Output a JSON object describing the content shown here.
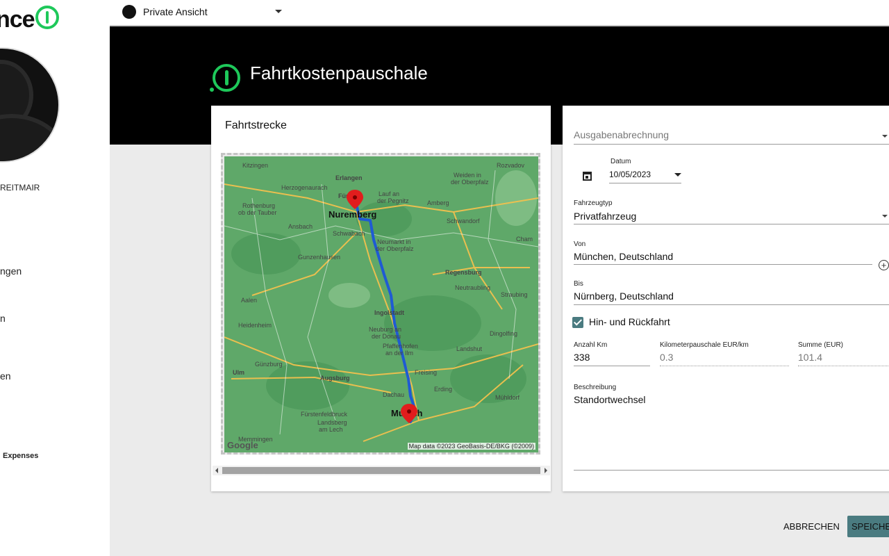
{
  "sidebar": {
    "logo_text": "nce",
    "user_name": "REITMAIR",
    "items": [
      {
        "label": "ngen"
      },
      {
        "label": "n"
      },
      {
        "label": "en"
      },
      {
        "label": "Expenses"
      }
    ]
  },
  "topbar": {
    "view_label": "Private Ansicht"
  },
  "header": {
    "title": "Fahrtkostenpauschale"
  },
  "map_card": {
    "title": "Fahrtstrecke",
    "attribution": "Map data ©2023 GeoBasis-DE/BKG (©2009)",
    "google": "Google",
    "places": [
      "Kitzingen",
      "Erlangen",
      "Weiden in",
      "der Oberpfalz",
      "Rozvadov",
      "Herzogenaurach",
      "Fürth",
      "Lauf an",
      "der Pegnitz",
      "Amberg",
      "Rothenburg",
      "ob der Tauber",
      "Nuremberg",
      "Schwandorf",
      "Ansbach",
      "Schwabach",
      "Neumarkt in",
      "der Oberpfalz",
      "Cham",
      "Gunzenhausen",
      "Regensburg",
      "Neutraubling",
      "Straubing",
      "Aalen",
      "Ingolstadt",
      "Heidenheim",
      "Neuburg an",
      "der Donau",
      "Dingolfing",
      "Pfaffenhofen",
      "an der Ilm",
      "Landshut",
      "Ulm",
      "Günzburg",
      "Augsburg",
      "Freising",
      "Erding",
      "Dachau",
      "Mühldorf",
      "Fürstenfeldbruck",
      "Munich",
      "Landsberg",
      "am Lech",
      "Memmingen"
    ]
  },
  "form": {
    "report_placeholder": "Ausgabenabrechnung",
    "date_label": "Datum",
    "date_value": "10/05/2023",
    "vehicle_label": "Fahrzeugtyp",
    "vehicle_value": "Privatfahrzeug",
    "from_label": "Von",
    "from_value": "München, Deutschland",
    "to_label": "Bis",
    "to_value": "Nürnberg, Deutschland",
    "roundtrip_label": "Hin- und Rückfahrt",
    "roundtrip_checked": true,
    "km_label": "Anzahl Km",
    "km_value": "338",
    "rate_label": "Kilometerpauschale EUR/km",
    "rate_value": "0.3",
    "sum_label": "Summe (EUR)",
    "sum_value": "101.4",
    "desc_label": "Beschreibung",
    "desc_value": "Standortwechsel"
  },
  "actions": {
    "cancel": "ABBRECHEN",
    "save": "SPEICHERN"
  },
  "colors": {
    "accent": "#1ec85a",
    "button": "#4a7b80",
    "header_bg": "#000000"
  }
}
